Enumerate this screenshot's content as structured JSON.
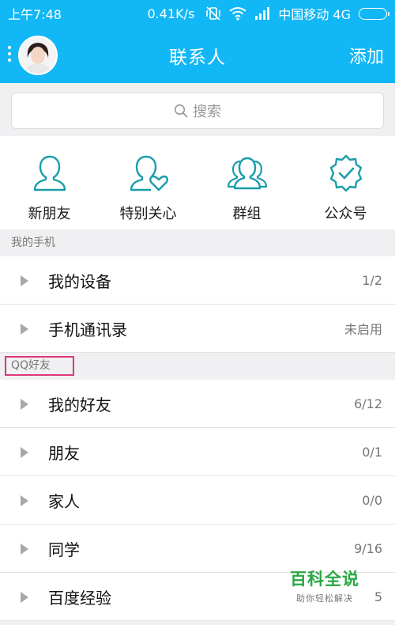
{
  "status_bar": {
    "time": "上午7:48",
    "speed": "0.41K/s",
    "carrier": "中国移动 4G"
  },
  "header": {
    "title": "联系人",
    "add_label": "添加"
  },
  "search": {
    "placeholder": "搜索"
  },
  "quick_entries": [
    {
      "label": "新朋友",
      "icon": "new-friend-icon"
    },
    {
      "label": "特别关心",
      "icon": "special-care-icon"
    },
    {
      "label": "群组",
      "icon": "group-icon"
    },
    {
      "label": "公众号",
      "icon": "official-account-icon"
    }
  ],
  "sections": {
    "my_phone": "我的手机",
    "qq_friends": "QQ好友"
  },
  "phone_rows": [
    {
      "name": "我的设备",
      "count": "1/2"
    },
    {
      "name": "手机通讯录",
      "count": "未启用"
    }
  ],
  "friend_rows": [
    {
      "name": "我的好友",
      "count": "6/12"
    },
    {
      "name": "朋友",
      "count": "0/1"
    },
    {
      "name": "家人",
      "count": "0/0"
    },
    {
      "name": "同学",
      "count": "9/16"
    },
    {
      "name": "百度经验",
      "count": "5"
    }
  ],
  "watermark": {
    "title": "百科全说",
    "subtitle": "助你轻松解决"
  },
  "colors": {
    "accent": "#12b7f5",
    "icon_teal": "#1a9dab",
    "highlight_box": "#e0357c",
    "watermark_green": "#28a745"
  }
}
